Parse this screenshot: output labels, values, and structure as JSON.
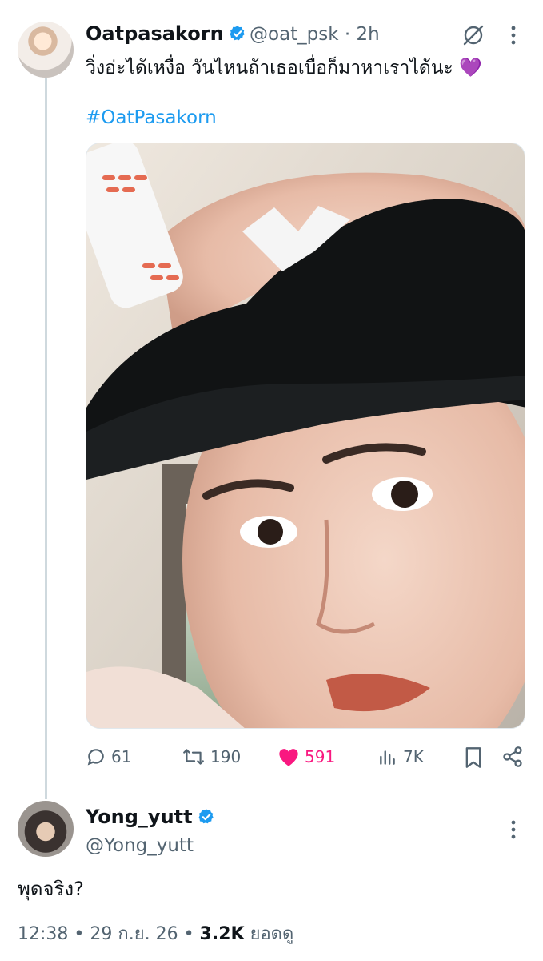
{
  "tweet": {
    "author_name": "Oatpasakorn",
    "handle": "@oat_psk",
    "separator": "·",
    "time": "2h",
    "text": "วิ่งอ่ะได้เหงื่อ วันไหนถ้าเธอเบื่อก็มาหาเราได้นะ 💜",
    "hashtag": "#OatPasakorn",
    "stats": {
      "replies": "61",
      "reposts": "190",
      "likes": "591",
      "views": "7K"
    }
  },
  "reply": {
    "author_name": "Yong_yutt",
    "handle": "@Yong_yutt",
    "text": "พุดจริง?",
    "time": "12:38",
    "date": "29 ก.ย. 26",
    "views_count": "3.2K",
    "views_label": "ยอดดู",
    "dot": "•"
  },
  "colors": {
    "accent": "#1d9bf0",
    "like": "#f91880",
    "muted": "#536471"
  }
}
